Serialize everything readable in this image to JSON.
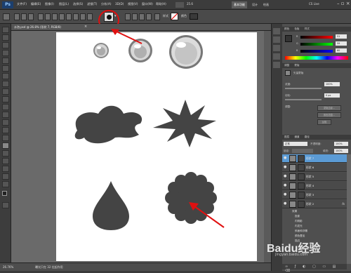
{
  "menubar": {
    "logo": "Ps",
    "items": [
      "文件(F)",
      "编辑(E)",
      "图像(I)",
      "图层(L)",
      "选择(S)",
      "滤镜(T)",
      "分析(A)",
      "3D(D)",
      "视图(V)",
      "窗口(W)",
      "帮助(H)"
    ],
    "zoom": "25.6",
    "workspace_buttons": [
      "基本功能",
      "设计",
      "绘画"
    ],
    "cs_live": "CS Live"
  },
  "options": {
    "style_label": "样式",
    "color_label": "颜色"
  },
  "document": {
    "tab_label": "水泡.psd @ 26.8% (形状 7, RGB/8)",
    "zoom_status": "26.76%",
    "doc_status": "曝光只在 32 位起作用"
  },
  "panel_color": {
    "tabs": [
      "颜色",
      "色板",
      "样式"
    ],
    "r_label": "R",
    "g_label": "G",
    "b_label": "B",
    "r": "51",
    "g": "59",
    "b": "60",
    "slider_r": 0.2,
    "slider_g": 0.23,
    "slider_b": 0.24
  },
  "panel_adjust": {
    "tabs": [
      "调整",
      "蒙版"
    ],
    "title": "矢量蒙版",
    "density_label": "浓度:",
    "density": "100%",
    "feather_label": "羽化:",
    "feather": "0 px",
    "refine_label": "调整:",
    "buttons": [
      "蒙版边缘...",
      "颜色范围...",
      "反相"
    ]
  },
  "panel_layers": {
    "tabs": [
      "图层",
      "通道",
      "路径"
    ],
    "blend_mode": "正常",
    "opacity_label": "不透明度:",
    "opacity": "100%",
    "lock_label": "锁定:",
    "fill_label": "填充:",
    "fill": "100%",
    "layers": [
      {
        "name": "形状 7",
        "fx": false,
        "active": true
      },
      {
        "name": "形状 6",
        "fx": false,
        "active": false
      },
      {
        "name": "形状 5",
        "fx": false,
        "active": false
      },
      {
        "name": "形状 4",
        "fx": false,
        "active": false
      },
      {
        "name": "形状 3",
        "fx": false,
        "active": false
      },
      {
        "name": "形状 2",
        "fx": true,
        "active": false
      }
    ],
    "effects_label": "效果",
    "effects": [
      "投影",
      "内阴影",
      "内发光",
      "斜面和浮雕",
      "颜色叠加",
      "描边"
    ]
  },
  "watermark": "Baidu经验",
  "watermark_sub": "jingyan.baidu.com",
  "colors": {
    "accent_red": "#e01010",
    "shape_fill": "#444444",
    "selection_blue": "#5b9bd5"
  }
}
